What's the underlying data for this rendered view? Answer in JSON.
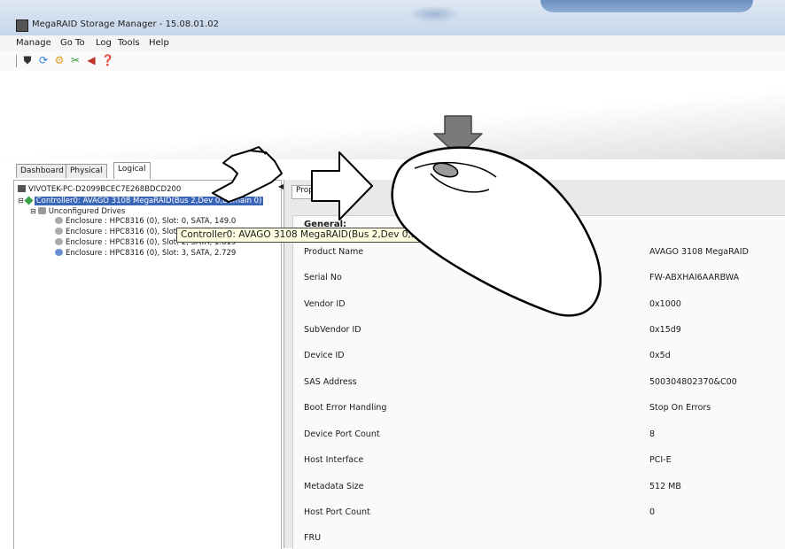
{
  "window": {
    "title": "MegaRAID Storage Manager - 15.08.01.02",
    "icon": "megaraid-app-icon"
  },
  "menu": [
    "Manage",
    "Go To",
    "Log",
    "Tools",
    "Help"
  ],
  "toolbar": [
    {
      "icon": "shield-icon",
      "glyph": "⛊",
      "color": "#333333"
    },
    {
      "icon": "refresh-icon",
      "glyph": "⟳",
      "color": "#2d7fd3"
    },
    {
      "icon": "settings-icon",
      "glyph": "⚙",
      "color": "#e0a020"
    },
    {
      "icon": "tools-icon",
      "glyph": "✂",
      "color": "#3a9a3a"
    },
    {
      "icon": "alert-icon",
      "glyph": "◀",
      "color": "#c0302a"
    },
    {
      "icon": "help-icon",
      "glyph": "❓",
      "color": "#2060c0"
    }
  ],
  "tabs": [
    "Dashboard",
    "Physical",
    "Logical"
  ],
  "active_tab": "Logical",
  "tree": [
    {
      "text": "VIVOTEK-PC-D2099BCEC7E268BDCD200",
      "icon": "computer-icon"
    },
    {
      "text": "Controller0: AVAGO 3108 MegaRAID(Bus 2,Dev 0,Domain 0)",
      "icon": "controller-icon",
      "selected": true
    },
    {
      "text": "Unconfigured Drives",
      "icon": "drives-group-icon"
    },
    {
      "text": "Enclosure : HPC8316 (0), Slot: 0, SATA, 149.0",
      "icon": "drive-icon"
    },
    {
      "text": "Enclosure : HPC8316 (0), Slot: 1, SATA, 149.0",
      "icon": "drive-icon"
    },
    {
      "text": "Enclosure : HPC8316 (0), Slot: 2, SATA, 1.819",
      "icon": "drive-icon"
    },
    {
      "text": "Enclosure : HPC8316 (0), Slot: 3, SATA, 2.729",
      "icon": "drive-icon"
    }
  ],
  "tooltip": "Controller0: AVAGO 3108 MegaRAID(Bus 2,Dev 0,Domain 0)",
  "right_tab": "Properties",
  "props_heading": "General:",
  "properties": [
    {
      "label": "Product Name",
      "value": "AVAGO 3108 MegaRAID"
    },
    {
      "label": "Serial No",
      "value": "FW-ABXHAI6AARBWA"
    },
    {
      "label": "Vendor ID",
      "value": "0x1000"
    },
    {
      "label": "SubVendor ID",
      "value": "0x15d9"
    },
    {
      "label": "Device ID",
      "value": "0x5d"
    },
    {
      "label": "SAS Address",
      "value": "500304802370&C00"
    },
    {
      "label": "Boot Error Handling",
      "value": "Stop On Errors"
    },
    {
      "label": "Device Port Count",
      "value": "8"
    },
    {
      "label": "Host Interface",
      "value": "PCI-E"
    },
    {
      "label": "Metadata Size",
      "value": "512 MB"
    },
    {
      "label": "Host Port Count",
      "value": "0"
    },
    {
      "label": "FRU",
      "value": ""
    }
  ],
  "colors": {
    "selection": "#3a66b8",
    "tooltip_bg": "#ffffe1",
    "pane_bg": "#e9e9e9"
  }
}
